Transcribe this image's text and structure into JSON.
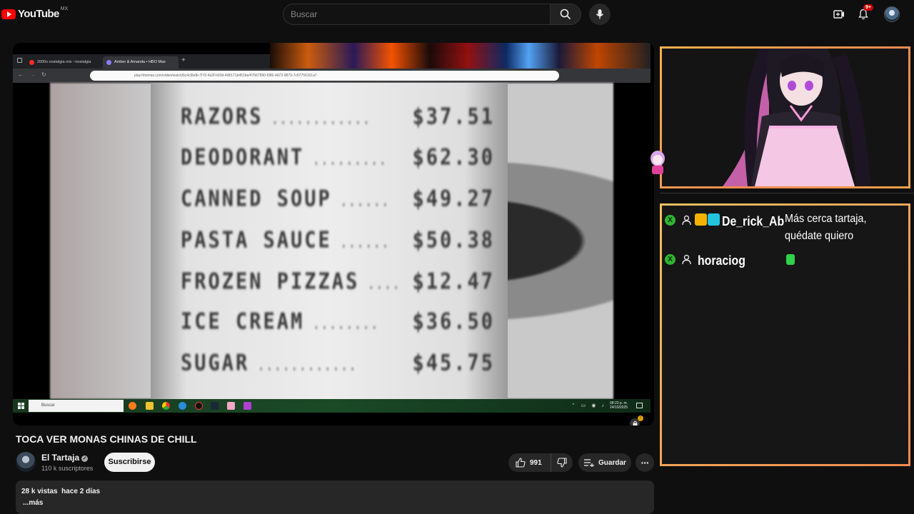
{
  "header": {
    "logo_text": "YouTube",
    "region": "MX",
    "search_placeholder": "Buscar",
    "notification_count": "9+"
  },
  "player": {
    "browser_tabs": [
      {
        "label": "2000s nostalgia mix ~nostalgia"
      },
      {
        "label": "Amber & Amanda • HBO Max"
      }
    ],
    "address": "play.hbomax.com/video/watch/6c4c9bdb-7f f3-4a2f-b93d-4d5171b451be/47567990-f386-4d73-9879-7c67756161a7",
    "receipt_items": [
      {
        "item": "RAZORS",
        "price": "$37.51"
      },
      {
        "item": "DEODORANT",
        "price": "$62.30"
      },
      {
        "item": "CANNED SOUP",
        "price": "$49.27"
      },
      {
        "item": "PASTA SAUCE",
        "price": "$50.38"
      },
      {
        "item": "FROZEN PIZZAS",
        "price": "$12.47"
      },
      {
        "item": "ICE CREAM",
        "price": "$36.50"
      },
      {
        "item": "SUGAR",
        "price": "$45.75"
      }
    ],
    "taskbar_search": "Buscar",
    "clock_time": "08:23 p. m.",
    "clock_date": "24/10/2025"
  },
  "video": {
    "title": "TOCA VER MONAS CHINAS DE CHILL",
    "channel_name": "El Tartaja",
    "subscribers": "110 k suscriptores",
    "subscribe_label": "Suscribirse",
    "likes": "991",
    "save_label": "Guardar",
    "views": "28 k vistas",
    "age": "hace 2 días",
    "more_label": "...más"
  },
  "chat": {
    "messages": [
      {
        "user": "De_rick_Ab",
        "text_line1": "Más cerca tartaja,",
        "text_line2": "quédate quiero"
      },
      {
        "user": "horaciog",
        "text_line1": "",
        "text_line2": ""
      }
    ]
  },
  "colors": {
    "brand_red": "#ff0000",
    "frame_orange": "#f08a50",
    "xbox_green": "#2fb52f"
  }
}
